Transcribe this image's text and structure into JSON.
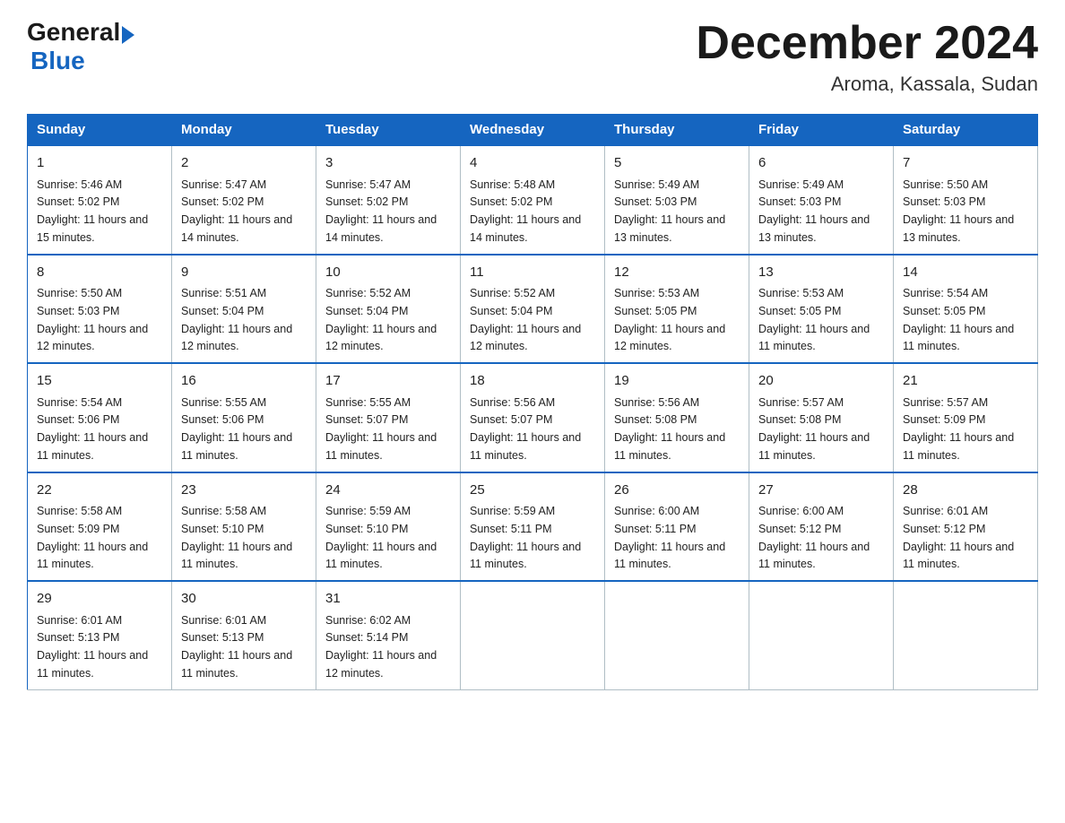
{
  "logo": {
    "general": "General",
    "arrow": "▶",
    "blue": "Blue"
  },
  "title": "December 2024",
  "subtitle": "Aroma, Kassala, Sudan",
  "days_of_week": [
    "Sunday",
    "Monday",
    "Tuesday",
    "Wednesday",
    "Thursday",
    "Friday",
    "Saturday"
  ],
  "weeks": [
    [
      {
        "day": "1",
        "sunrise": "5:46 AM",
        "sunset": "5:02 PM",
        "daylight": "11 hours and 15 minutes."
      },
      {
        "day": "2",
        "sunrise": "5:47 AM",
        "sunset": "5:02 PM",
        "daylight": "11 hours and 14 minutes."
      },
      {
        "day": "3",
        "sunrise": "5:47 AM",
        "sunset": "5:02 PM",
        "daylight": "11 hours and 14 minutes."
      },
      {
        "day": "4",
        "sunrise": "5:48 AM",
        "sunset": "5:02 PM",
        "daylight": "11 hours and 14 minutes."
      },
      {
        "day": "5",
        "sunrise": "5:49 AM",
        "sunset": "5:03 PM",
        "daylight": "11 hours and 13 minutes."
      },
      {
        "day": "6",
        "sunrise": "5:49 AM",
        "sunset": "5:03 PM",
        "daylight": "11 hours and 13 minutes."
      },
      {
        "day": "7",
        "sunrise": "5:50 AM",
        "sunset": "5:03 PM",
        "daylight": "11 hours and 13 minutes."
      }
    ],
    [
      {
        "day": "8",
        "sunrise": "5:50 AM",
        "sunset": "5:03 PM",
        "daylight": "11 hours and 12 minutes."
      },
      {
        "day": "9",
        "sunrise": "5:51 AM",
        "sunset": "5:04 PM",
        "daylight": "11 hours and 12 minutes."
      },
      {
        "day": "10",
        "sunrise": "5:52 AM",
        "sunset": "5:04 PM",
        "daylight": "11 hours and 12 minutes."
      },
      {
        "day": "11",
        "sunrise": "5:52 AM",
        "sunset": "5:04 PM",
        "daylight": "11 hours and 12 minutes."
      },
      {
        "day": "12",
        "sunrise": "5:53 AM",
        "sunset": "5:05 PM",
        "daylight": "11 hours and 12 minutes."
      },
      {
        "day": "13",
        "sunrise": "5:53 AM",
        "sunset": "5:05 PM",
        "daylight": "11 hours and 11 minutes."
      },
      {
        "day": "14",
        "sunrise": "5:54 AM",
        "sunset": "5:05 PM",
        "daylight": "11 hours and 11 minutes."
      }
    ],
    [
      {
        "day": "15",
        "sunrise": "5:54 AM",
        "sunset": "5:06 PM",
        "daylight": "11 hours and 11 minutes."
      },
      {
        "day": "16",
        "sunrise": "5:55 AM",
        "sunset": "5:06 PM",
        "daylight": "11 hours and 11 minutes."
      },
      {
        "day": "17",
        "sunrise": "5:55 AM",
        "sunset": "5:07 PM",
        "daylight": "11 hours and 11 minutes."
      },
      {
        "day": "18",
        "sunrise": "5:56 AM",
        "sunset": "5:07 PM",
        "daylight": "11 hours and 11 minutes."
      },
      {
        "day": "19",
        "sunrise": "5:56 AM",
        "sunset": "5:08 PM",
        "daylight": "11 hours and 11 minutes."
      },
      {
        "day": "20",
        "sunrise": "5:57 AM",
        "sunset": "5:08 PM",
        "daylight": "11 hours and 11 minutes."
      },
      {
        "day": "21",
        "sunrise": "5:57 AM",
        "sunset": "5:09 PM",
        "daylight": "11 hours and 11 minutes."
      }
    ],
    [
      {
        "day": "22",
        "sunrise": "5:58 AM",
        "sunset": "5:09 PM",
        "daylight": "11 hours and 11 minutes."
      },
      {
        "day": "23",
        "sunrise": "5:58 AM",
        "sunset": "5:10 PM",
        "daylight": "11 hours and 11 minutes."
      },
      {
        "day": "24",
        "sunrise": "5:59 AM",
        "sunset": "5:10 PM",
        "daylight": "11 hours and 11 minutes."
      },
      {
        "day": "25",
        "sunrise": "5:59 AM",
        "sunset": "5:11 PM",
        "daylight": "11 hours and 11 minutes."
      },
      {
        "day": "26",
        "sunrise": "6:00 AM",
        "sunset": "5:11 PM",
        "daylight": "11 hours and 11 minutes."
      },
      {
        "day": "27",
        "sunrise": "6:00 AM",
        "sunset": "5:12 PM",
        "daylight": "11 hours and 11 minutes."
      },
      {
        "day": "28",
        "sunrise": "6:01 AM",
        "sunset": "5:12 PM",
        "daylight": "11 hours and 11 minutes."
      }
    ],
    [
      {
        "day": "29",
        "sunrise": "6:01 AM",
        "sunset": "5:13 PM",
        "daylight": "11 hours and 11 minutes."
      },
      {
        "day": "30",
        "sunrise": "6:01 AM",
        "sunset": "5:13 PM",
        "daylight": "11 hours and 11 minutes."
      },
      {
        "day": "31",
        "sunrise": "6:02 AM",
        "sunset": "5:14 PM",
        "daylight": "11 hours and 12 minutes."
      },
      null,
      null,
      null,
      null
    ]
  ]
}
